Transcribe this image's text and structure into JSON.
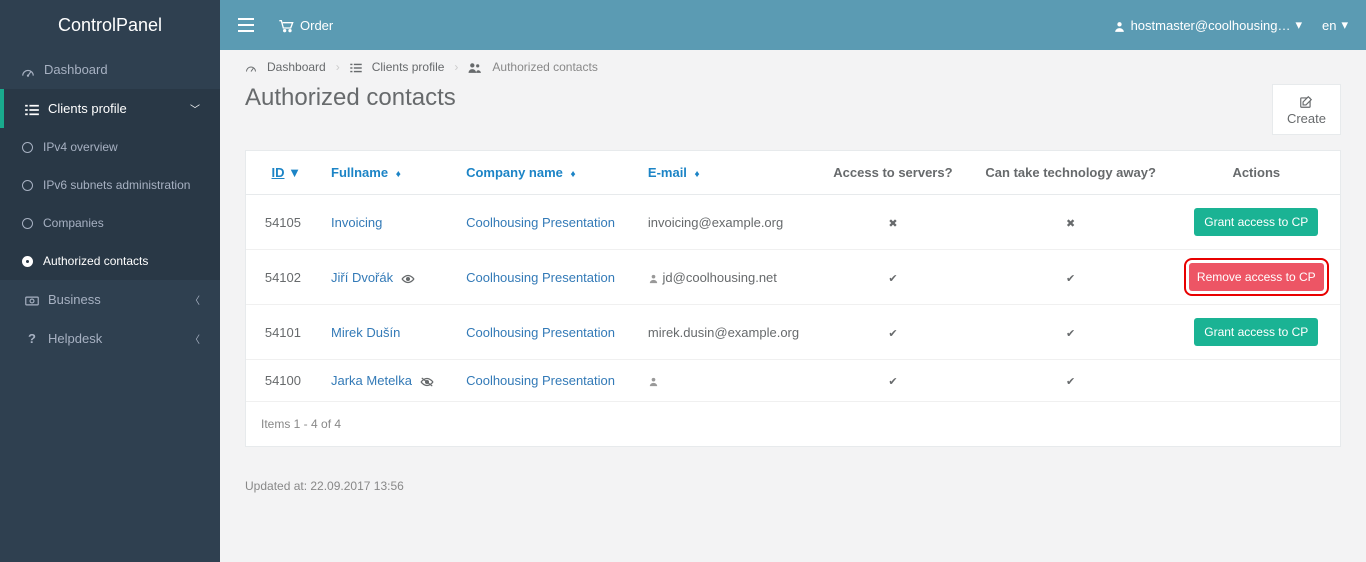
{
  "brand": "ControlPanel",
  "topbar": {
    "order_label": "Order",
    "user": "hostmaster@coolhousing…",
    "lang": "en"
  },
  "sidebar": {
    "dashboard": "Dashboard",
    "clients_profile": "Clients profile",
    "sub": {
      "ipv4": "IPv4 overview",
      "ipv6": "IPv6 subnets administration",
      "companies": "Companies",
      "authorized": "Authorized contacts"
    },
    "business": "Business",
    "helpdesk": "Helpdesk"
  },
  "breadcrumbs": {
    "dashboard": "Dashboard",
    "clients_profile": "Clients profile",
    "authorized": "Authorized contacts"
  },
  "page": {
    "title": "Authorized contacts",
    "create": "Create"
  },
  "table": {
    "headers": {
      "id": "ID",
      "fullname": "Fullname",
      "company": "Company name",
      "email": "E-mail",
      "access": "Access to servers?",
      "takeaway": "Can take technology away?",
      "actions": "Actions"
    },
    "rows": [
      {
        "id": "54105",
        "fullname": "Invoicing",
        "eye": false,
        "company": "Coolhousing Presentation",
        "email": "invoicing@example.org",
        "user_icon": false,
        "access": false,
        "takeaway": false,
        "action_label": "Grant access to CP",
        "action_color": "green",
        "highlight": false
      },
      {
        "id": "54102",
        "fullname": "Jiří Dvořák",
        "eye": true,
        "eye_slash": false,
        "company": "Coolhousing Presentation",
        "email": "jd@coolhousing.net",
        "user_icon": true,
        "access": true,
        "takeaway": true,
        "action_label": "Remove access to CP",
        "action_color": "red",
        "highlight": true
      },
      {
        "id": "54101",
        "fullname": "Mirek Dušín",
        "eye": false,
        "company": "Coolhousing Presentation",
        "email": "mirek.dusin@example.org",
        "user_icon": false,
        "access": true,
        "takeaway": true,
        "action_label": "Grant access to CP",
        "action_color": "green",
        "highlight": false
      },
      {
        "id": "54100",
        "fullname": "Jarka Metelka",
        "eye": true,
        "eye_slash": true,
        "company": "Coolhousing Presentation",
        "email": "",
        "user_icon": true,
        "access": true,
        "takeaway": true,
        "action_label": "",
        "action_color": "",
        "highlight": false
      }
    ],
    "items_info": "Items 1 - 4 of 4"
  },
  "footer": "Updated at: 22.09.2017 13:56"
}
